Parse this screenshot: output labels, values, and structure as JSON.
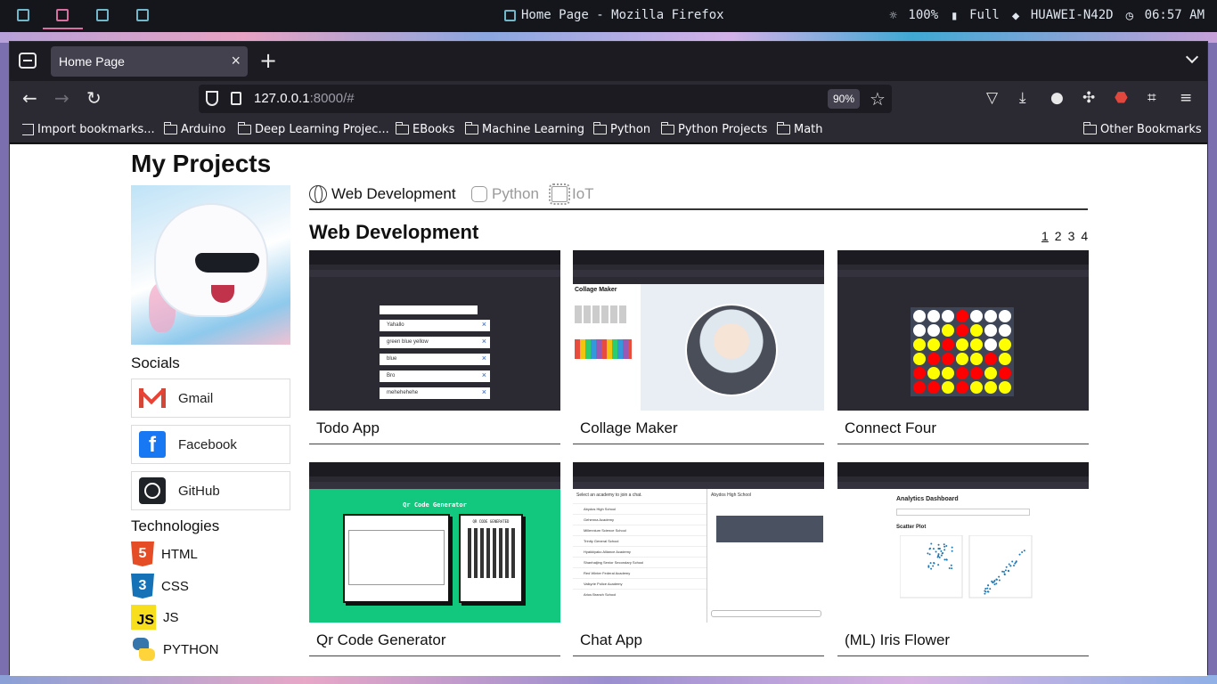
{
  "system": {
    "window_title": "Home Page - Mozilla Firefox",
    "brightness": "100%",
    "battery": "Full",
    "wifi": "HUAWEI-N42D",
    "clock": "06:57 AM"
  },
  "browser": {
    "tab_title": "Home Page",
    "url_host": "127.0.0.1",
    "url_rest": ":8000/#",
    "zoom": "90%",
    "bookmarks": [
      "Import bookmarks...",
      "Arduino",
      "Deep Learning Projec...",
      "EBooks",
      "Machine Learning",
      "Python",
      "Python Projects",
      "Math"
    ],
    "other_bookmarks": "Other Bookmarks"
  },
  "page": {
    "title": "My Projects",
    "socials_heading": "Socials",
    "socials": [
      "Gmail",
      "Facebook",
      "GitHub"
    ],
    "technologies_heading": "Technologies",
    "technologies": [
      "HTML",
      "CSS",
      "JS",
      "PYTHON"
    ],
    "tabs": [
      "Web Development",
      "Python",
      "IoT"
    ],
    "section_title": "Web Development",
    "pages": [
      "1",
      "2",
      "3",
      "4"
    ],
    "projects": [
      "Todo App",
      "Collage Maker",
      "Connect Four",
      "Qr Code Generator",
      "Chat App",
      "(ML) Iris Flower"
    ]
  },
  "thumbs": {
    "todo_items": [
      "Yahallo",
      "green blue yellow",
      "blue",
      "Bro",
      "mehehehehe"
    ],
    "collage_title": "Collage Maker",
    "qr_title": "Qr Code Generator",
    "qr_generated": "QR CODE GENERATED",
    "chat_prompt": "Select an academy to join a chat.",
    "chat_room": "Abydos High School",
    "chat_academies": [
      "Abydos High School",
      "Gehenna Academy",
      "Millennium Science School",
      "Trinity General School",
      "Hyakkiyako Alliance Academy",
      "Shanhaijing Senior Secondary School",
      "Red Winter Federal Academy",
      "Valkyrie Police Academy",
      "Arius Branch School"
    ],
    "iris_title": "Analytics Dashboard",
    "iris_chart": "Scatter Plot"
  },
  "colors": {
    "accent": "#1c1b22",
    "qr_green": "#12c77e",
    "c4_red": "#ff0000",
    "c4_yellow": "#ffff00"
  }
}
